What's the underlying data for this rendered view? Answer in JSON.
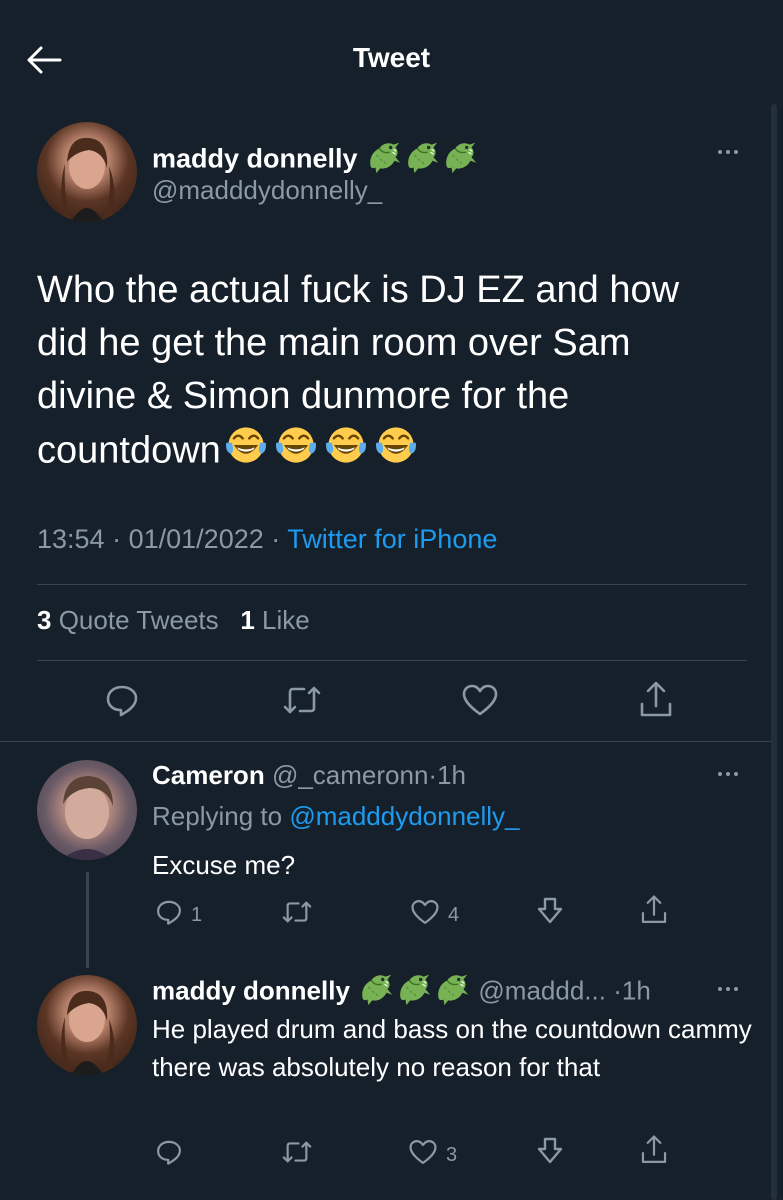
{
  "header": {
    "title": "Tweet"
  },
  "tweet": {
    "author_name": "maddy donnelly",
    "author_handle": "@madddydonnelly_",
    "name_emojis": [
      "crocodile",
      "crocodile",
      "crocodile"
    ],
    "text": "Who the actual fuck is DJ EZ and how did he get the main room over Sam divine & Simon dunmore for the countdown",
    "text_emojis": [
      "face-with-tears-of-joy",
      "face-with-tears-of-joy",
      "face-with-tears-of-joy",
      "face-with-tears-of-joy"
    ],
    "time": "13:54",
    "date": "01/01/2022",
    "separator": "·",
    "source": "Twitter for iPhone",
    "quote_count": "3",
    "quote_label": "Quote Tweets",
    "like_count": "1",
    "like_label": "Like"
  },
  "replies": [
    {
      "author_name": "Cameron",
      "author_handle": "@_cameronn",
      "separator": "·",
      "time": "1h",
      "replying_prefix": "Replying to",
      "replying_handle": "@madddydonnelly_",
      "text": "Excuse me?",
      "reply_count": "1",
      "like_count": "4"
    },
    {
      "author_name": "maddy donnelly",
      "author_handle": "@maddd...",
      "separator": "·",
      "time": "1h",
      "name_emojis": [
        "crocodile",
        "crocodile",
        "crocodile"
      ],
      "text": "He played drum and bass on the countdown cammy there was absolutely no reason for that",
      "like_count": "3"
    }
  ],
  "icons": {
    "back": "arrow-left-icon",
    "more": "more-dots-icon",
    "reply": "reply-icon",
    "retweet": "retweet-icon",
    "like": "heart-icon",
    "share": "share-icon",
    "downvote": "downvote-icon"
  },
  "colors": {
    "background": "#15202b",
    "text": "#ffffff",
    "muted": "#8b98a5",
    "link": "#1d9bf0",
    "divider": "#38444d"
  }
}
